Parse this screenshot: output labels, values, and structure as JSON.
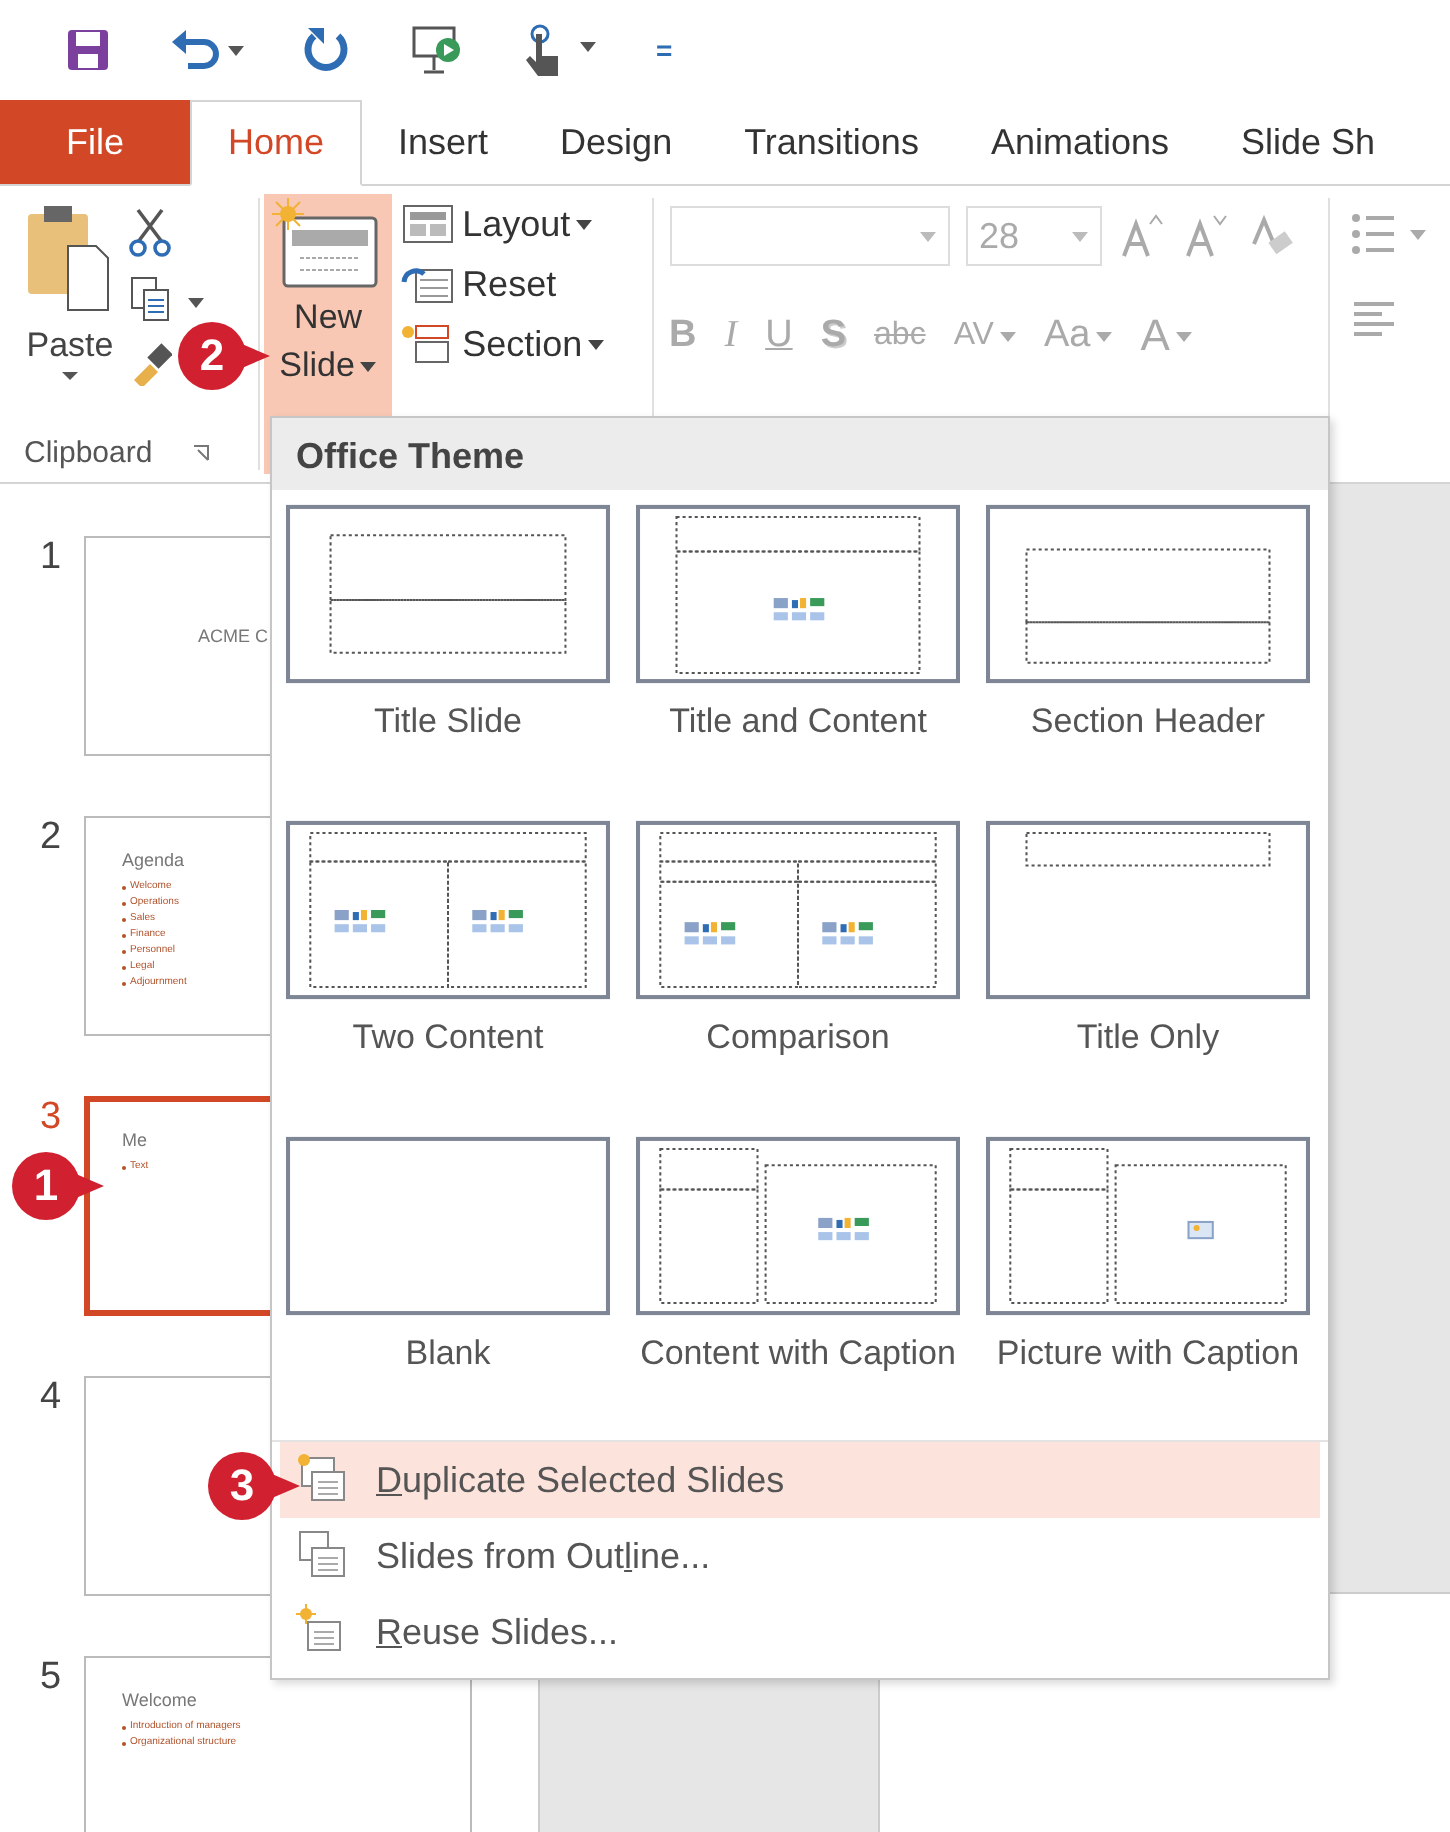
{
  "quick_access": {
    "customize_glyph": "="
  },
  "tabs": [
    {
      "label": "File",
      "kind": "file",
      "selected": false
    },
    {
      "label": "Home",
      "kind": "tab",
      "selected": true
    },
    {
      "label": "Insert",
      "kind": "tab",
      "selected": false
    },
    {
      "label": "Design",
      "kind": "tab",
      "selected": false
    },
    {
      "label": "Transitions",
      "kind": "tab",
      "selected": false
    },
    {
      "label": "Animations",
      "kind": "tab",
      "selected": false
    },
    {
      "label": "Slide Sh",
      "kind": "tab",
      "selected": false
    }
  ],
  "ribbon": {
    "clipboard": {
      "paste": "Paste",
      "group_label": "Clipboard"
    },
    "slides": {
      "new_slide_top": "New",
      "new_slide_bottom": "Slide",
      "new_slide_highlighted": true,
      "commands": [
        "Layout",
        "Reset",
        "Section"
      ]
    },
    "font": {
      "font_size": "28",
      "format_buttons": [
        {
          "label": "B",
          "kind": "bold"
        },
        {
          "label": "I",
          "kind": "italic"
        },
        {
          "label": "U",
          "kind": "underline"
        },
        {
          "label": "S",
          "kind": "shadow"
        },
        {
          "label": "abc",
          "kind": "strike"
        },
        {
          "label": "AV",
          "kind": "spacing"
        },
        {
          "label": "Aa",
          "kind": "case"
        },
        {
          "label": "A",
          "kind": "color"
        }
      ]
    }
  },
  "slides": [
    {
      "number": "1",
      "selected": false,
      "title": "ACME C"
    },
    {
      "number": "2",
      "selected": false,
      "title": "Agenda",
      "bullets": [
        "Welcome",
        "Operations",
        "Sales",
        "Finance",
        "Personnel",
        "Legal",
        "Adjournment"
      ]
    },
    {
      "number": "3",
      "selected": true,
      "title": "Me",
      "bullets": [
        "Text"
      ]
    },
    {
      "number": "4",
      "selected": false
    },
    {
      "number": "5",
      "selected": false,
      "title": "Welcome",
      "bullets": [
        "Introduction of managers",
        "Organizational structure"
      ]
    }
  ],
  "new_slide_menu": {
    "header": "Office Theme",
    "layouts": [
      {
        "label": "Title Slide",
        "kind": "title"
      },
      {
        "label": "Title and Content",
        "kind": "title_content"
      },
      {
        "label": "Section Header",
        "kind": "section"
      },
      {
        "label": "Two Content",
        "kind": "two_content"
      },
      {
        "label": "Comparison",
        "kind": "comparison"
      },
      {
        "label": "Title Only",
        "kind": "title_only"
      },
      {
        "label": "Blank",
        "kind": "blank"
      },
      {
        "label": "Content with Caption",
        "kind": "content_caption"
      },
      {
        "label": "Picture with Caption",
        "kind": "picture_caption"
      }
    ],
    "commands": [
      {
        "access_key": "D",
        "rest": "uplicate Selected Slides",
        "kind": "duplicate",
        "highlighted": true
      },
      {
        "before": "Slides from Out",
        "access_key": "l",
        "rest": "ine...",
        "kind": "outline",
        "highlighted": false
      },
      {
        "access_key": "R",
        "rest": "euse Slides...",
        "kind": "reuse",
        "highlighted": false
      }
    ]
  },
  "callouts": [
    "1",
    "2",
    "3"
  ]
}
